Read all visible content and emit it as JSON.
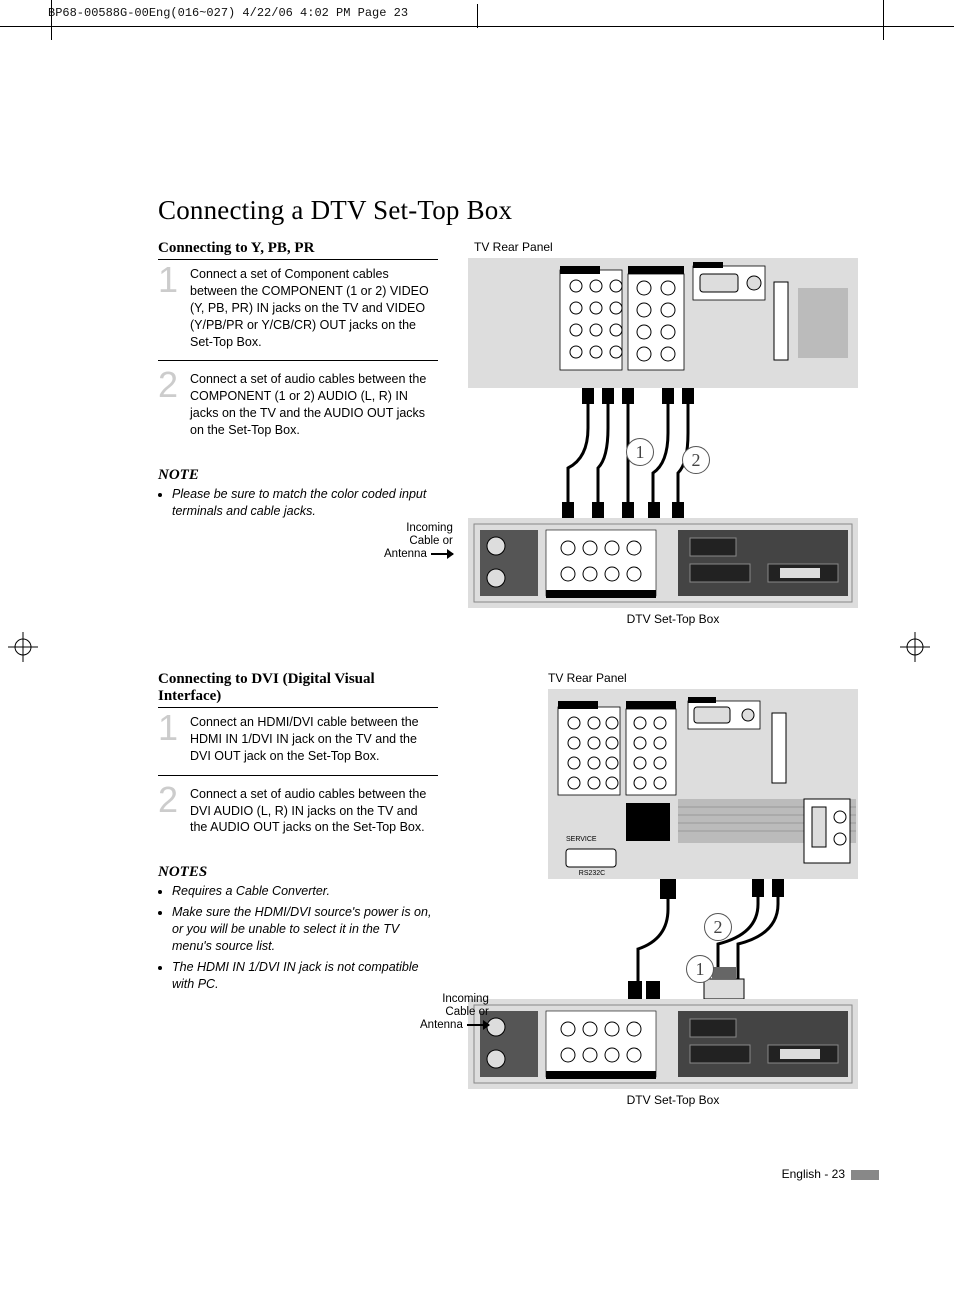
{
  "header": {
    "imprint": "BP68-00588G-00Eng(016~027)  4/22/06  4:02 PM  Page 23"
  },
  "title": "Connecting a DTV Set-Top Box",
  "section1": {
    "heading_main": "Connecting to Y, ",
    "heading_pb": "PB",
    "heading_pr": "PR",
    "step1_text": "Connect a set of Component cables between the COMPONENT (1 or 2) VIDEO (Y, PB, PR) IN jacks on the TV and VIDEO (Y/PB/PR or Y/CB/CR) OUT jacks on the Set-Top Box.",
    "step2_text": "Connect a set of audio cables between the COMPONENT (1 or 2) AUDIO (L, R) IN jacks on the TV and the AUDIO OUT jacks on the Set-Top Box.",
    "note_heading": "NOTE",
    "note_bullet1": "Please be sure to match the color coded input terminals and cable jacks.",
    "panel_label_top": "TV Rear Panel",
    "bottom_label": "DTV Set-Top Box",
    "incoming_label": "Incoming\nCable or\nAntenna",
    "circle1": "1",
    "circle2": "2"
  },
  "section2": {
    "heading": "Connecting to DVI (Digital Visual Interface)",
    "step1_text": "Connect an HDMI/DVI cable between the HDMI IN 1/DVI IN jack on the TV and the DVI OUT jack on the Set-Top Box.",
    "step2_text": "Connect a set of audio cables between the DVI AUDIO (L, R) IN jacks on the TV and the AUDIO OUT jacks on the Set-Top Box.",
    "notes_heading": "NOTES",
    "notes_bullet1": "Requires a Cable Converter.",
    "notes_bullet2": "Make sure the HDMI/DVI source's power is on, or you will be unable to select it in the TV menu's source list.",
    "notes_bullet3": "The HDMI IN 1/DVI IN jack is not compatible with PC.",
    "panel_label_top": "TV Rear Panel",
    "bottom_label": "DTV Set-Top Box",
    "incoming_label": "Incoming\nCable or\nAntenna",
    "circle1": "1",
    "circle2": "2"
  },
  "footer": {
    "text": "English - 23"
  },
  "steps": {
    "num1": "1",
    "num2": "2"
  }
}
